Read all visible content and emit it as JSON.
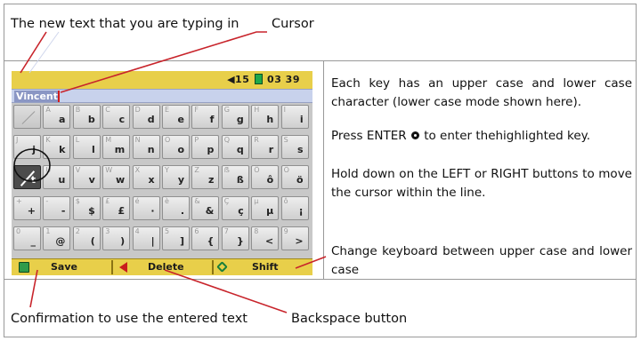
{
  "captions": {
    "new_text": "The new text that you are typing in",
    "cursor": "Cursor",
    "confirmation": "Confirmation to use the entered text",
    "backspace": "Backspace button"
  },
  "descriptions": {
    "upper_lower": "Each key has an upper case and lower case character (lower case mode shown here).",
    "press_enter_before": "Press ENTER",
    "press_enter_after": "to enter thehighlighted key.",
    "hold_down": "Hold down on the LEFT or RIGHT buttons to move the cursor within the line.",
    "change_keyboard": "Change keyboard between upper case and lower case"
  },
  "device": {
    "status": "15",
    "clock": "03 39",
    "input_text": "Vincent",
    "buttons": {
      "save": "Save",
      "delete": "Delete",
      "shift": "Shift"
    },
    "colors": {
      "bar": "#e8cf4a",
      "input": "#c8d2ec",
      "highlight": "#4c4c4c",
      "cursor": "#d21b1b",
      "annotation": "#c8242b"
    },
    "keys": [
      [
        [
          "",
          ""
        ],
        [
          "A",
          "a"
        ],
        [
          "B",
          "b"
        ],
        [
          "C",
          "c"
        ],
        [
          "D",
          "d"
        ],
        [
          "E",
          "e"
        ],
        [
          "F",
          "f"
        ],
        [
          "G",
          "g"
        ],
        [
          "H",
          "h"
        ],
        [
          "I",
          "i"
        ]
      ],
      [
        [
          "J",
          "j"
        ],
        [
          "K",
          "k"
        ],
        [
          "L",
          "l"
        ],
        [
          "M",
          "m"
        ],
        [
          "N",
          "n"
        ],
        [
          "O",
          "o"
        ],
        [
          "P",
          "p"
        ],
        [
          "Q",
          "q"
        ],
        [
          "R",
          "r"
        ],
        [
          "S",
          "s"
        ]
      ],
      [
        [
          "T",
          "t"
        ],
        [
          "U",
          "u"
        ],
        [
          "V",
          "v"
        ],
        [
          "W",
          "w"
        ],
        [
          "X",
          "x"
        ],
        [
          "Y",
          "y"
        ],
        [
          "Z",
          "z"
        ],
        [
          "ẞ",
          "ß"
        ],
        [
          "Ô",
          "ô"
        ],
        [
          "Ö",
          "ö"
        ]
      ],
      [
        [
          "+",
          "+"
        ],
        [
          "-",
          "-"
        ],
        [
          "$",
          "$"
        ],
        [
          "£",
          "£"
        ],
        [
          "é",
          "·"
        ],
        [
          "è",
          "."
        ],
        [
          "&",
          "&"
        ],
        [
          "Ç",
          "ç"
        ],
        [
          "µ",
          "µ"
        ],
        [
          "ô",
          "¡"
        ]
      ],
      [
        [
          "0",
          "_"
        ],
        [
          "1",
          "@"
        ],
        [
          "2",
          "("
        ],
        [
          "3",
          ")"
        ],
        [
          "4",
          "|"
        ],
        [
          "5",
          "]"
        ],
        [
          "6",
          "{"
        ],
        [
          "7",
          "}"
        ],
        [
          "8",
          "<"
        ],
        [
          "9",
          ">"
        ]
      ]
    ]
  }
}
